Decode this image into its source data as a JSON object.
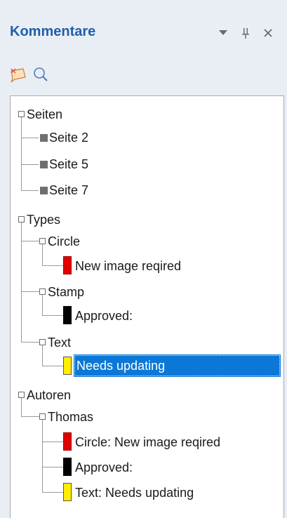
{
  "header": {
    "title": "Kommentare",
    "menu_glyph": "▾",
    "pin_glyph": "ᵽ",
    "close_glyph": "×"
  },
  "toolbar": {
    "items": [
      {
        "icon": "comment-note-icon"
      },
      {
        "icon": "search-icon"
      }
    ]
  },
  "tree": {
    "seiten": {
      "label": "Seiten",
      "children": [
        "Seite 2",
        "Seite 5",
        "Seite 7"
      ]
    },
    "types": {
      "label": "Types",
      "circle": {
        "label": "Circle",
        "child": "New image reqired",
        "color": "#e00000"
      },
      "stamp": {
        "label": "Stamp",
        "child": "Approved:",
        "color": "#000000"
      },
      "text": {
        "label": "Text",
        "child": "Needs updating",
        "color": "#ffee00"
      }
    },
    "autoren": {
      "label": "Autoren",
      "thomas": {
        "label": "Thomas",
        "children": [
          {
            "label": "Circle: New image reqired",
            "color": "#e00000"
          },
          {
            "label": "Approved:",
            "color": "#000000"
          },
          {
            "label": "Text: Needs updating",
            "color": "#ffee00"
          }
        ]
      }
    }
  },
  "selection": "Needs updating",
  "colors": {
    "accent": "#1f5fa8",
    "selection": "#0b78d7"
  }
}
